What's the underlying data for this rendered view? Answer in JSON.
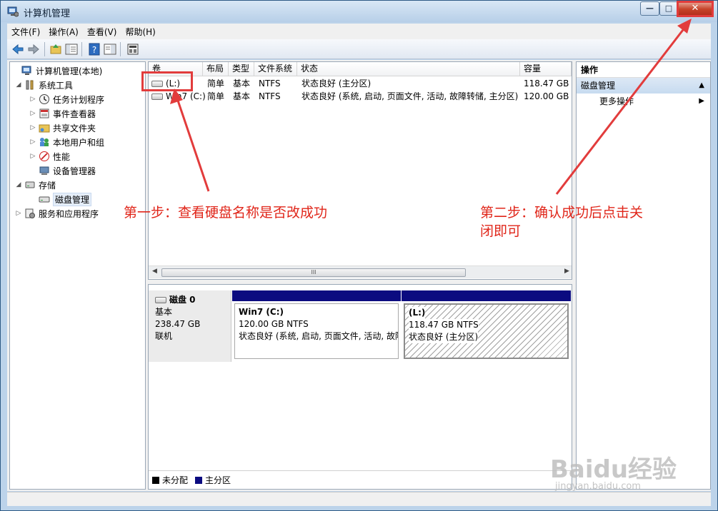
{
  "window": {
    "title": "计算机管理",
    "min_glyph": "—",
    "max_glyph": "□",
    "close_glyph": "✕"
  },
  "menu": [
    "文件(F)",
    "操作(A)",
    "查看(V)",
    "帮助(H)"
  ],
  "toolbar_icons": [
    "back-icon",
    "forward-icon",
    "up-folder-icon",
    "console-tree-icon",
    "help-icon",
    "show-hide-icon",
    "properties-icon"
  ],
  "tree": [
    {
      "label": "计算机管理(本地)",
      "level": 0,
      "arrow": "",
      "icon": "computer-management-icon"
    },
    {
      "label": "系统工具",
      "level": 1,
      "arrow": "◢",
      "icon": "tools-icon"
    },
    {
      "label": "任务计划程序",
      "level": 2,
      "arrow": "▷",
      "icon": "clock-icon"
    },
    {
      "label": "事件查看器",
      "level": 2,
      "arrow": "▷",
      "icon": "event-viewer-icon"
    },
    {
      "label": "共享文件夹",
      "level": 2,
      "arrow": "▷",
      "icon": "shared-folder-icon"
    },
    {
      "label": "本地用户和组",
      "level": 2,
      "arrow": "▷",
      "icon": "users-icon"
    },
    {
      "label": "性能",
      "level": 2,
      "arrow": "▷",
      "icon": "performance-icon"
    },
    {
      "label": "设备管理器",
      "level": 2,
      "arrow": "",
      "icon": "device-manager-icon"
    },
    {
      "label": "存储",
      "level": 1,
      "arrow": "◢",
      "icon": "storage-icon"
    },
    {
      "label": "磁盘管理",
      "level": 2,
      "arrow": "",
      "icon": "disk-management-icon",
      "selected": true
    },
    {
      "label": "服务和应用程序",
      "level": 1,
      "arrow": "▷",
      "icon": "services-icon"
    }
  ],
  "volume_columns": [
    "卷",
    "布局",
    "类型",
    "文件系统",
    "状态",
    "容量"
  ],
  "volumes": [
    {
      "name": "(L:)",
      "layout": "简单",
      "type": "基本",
      "fs": "NTFS",
      "status": "状态良好 (主分区)",
      "capacity": "118.47 GB"
    },
    {
      "name": "Win7 (C:)",
      "layout": "简单",
      "type": "基本",
      "fs": "NTFS",
      "status": "状态良好 (系统, 启动, 页面文件, 活动, 故障转储, 主分区)",
      "capacity": "120.00 GB"
    }
  ],
  "disk": {
    "name": "磁盘 0",
    "type": "基本",
    "size": "238.47 GB",
    "state": "联机",
    "partitions": [
      {
        "title": "Win7  (C:)",
        "size": "120.00 GB NTFS",
        "status": "状态良好 (系统, 启动, 页面文件, 活动, 故障"
      },
      {
        "title": "(L:)",
        "size": "118.47 GB NTFS",
        "status": "状态良好 (主分区)"
      }
    ]
  },
  "legend": [
    {
      "label": "未分配",
      "color": "#000000"
    },
    {
      "label": "主分区",
      "color": "#0b0b80"
    }
  ],
  "actions": {
    "header": "操作",
    "section": "磁盘管理",
    "more": "更多操作"
  },
  "annotations": {
    "step1": "第一步：查看硬盘名称是否改成功",
    "step2_line1": "第二步：确认成功后点击关",
    "step2_line2": "闭即可",
    "color": "#e0261a"
  },
  "watermark": {
    "brand": "Baidu经验",
    "url": "jingyan.baidu.com"
  }
}
